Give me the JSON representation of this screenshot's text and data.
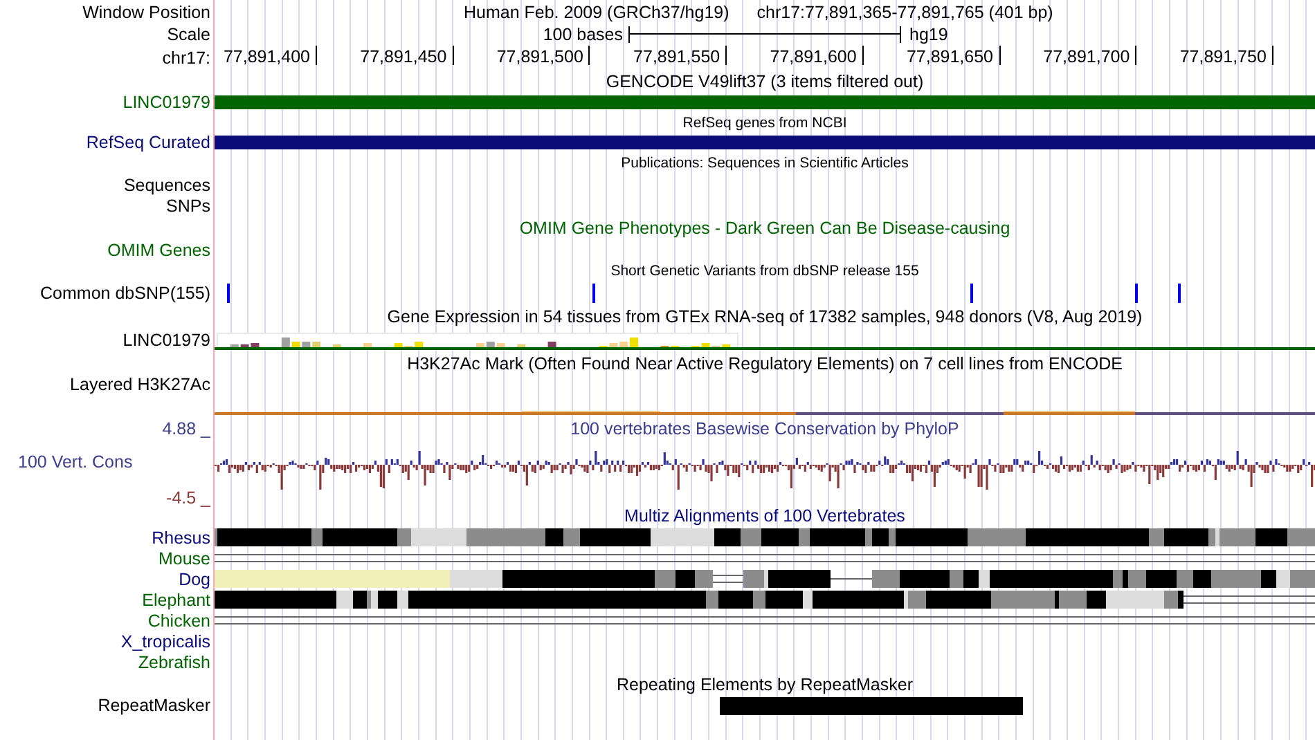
{
  "rows": [
    {
      "kind": "header",
      "label": {
        "text": "Window Position",
        "color": "#000000"
      },
      "title": "Human Feb. 2009 (GRCh37/hg19)",
      "position": "chr17:77,891,365-77,891,765 (401 bp)"
    },
    {
      "kind": "scale",
      "label": {
        "text": "Scale",
        "color": "#000000"
      },
      "scale_text": "100 bases",
      "assembly": "hg19"
    },
    {
      "kind": "ruler",
      "label": {
        "text": "chr17:",
        "color": "#000000"
      },
      "ticks": [
        "77,891,400",
        "77,891,450",
        "77,891,500",
        "77,891,550",
        "77,891,600",
        "77,891,650",
        "77,891,700",
        "77,891,750"
      ]
    },
    {
      "kind": "title",
      "title": {
        "text": "GENCODE V49lift37 (3 items filtered out)",
        "color": "#000000"
      }
    },
    {
      "kind": "gene",
      "label": {
        "text": "LINC01979",
        "color": "#006400"
      },
      "color": "#006400"
    },
    {
      "kind": "small-title",
      "title": {
        "text": "RefSeq genes from NCBI",
        "color": "#000000"
      }
    },
    {
      "kind": "gene",
      "label": {
        "text": "RefSeq Curated",
        "color": "#0c0c78"
      },
      "color": "#0c0c78"
    },
    {
      "kind": "small-title",
      "title": {
        "text": "Publications: Sequences in Scientific Articles",
        "color": "#000000"
      }
    },
    {
      "kind": "label",
      "label": {
        "text": "Sequences",
        "color": "#000000"
      }
    },
    {
      "kind": "label",
      "label": {
        "text": "SNPs",
        "color": "#000000"
      }
    },
    {
      "kind": "title",
      "title": {
        "text": "OMIM Gene Phenotypes - Dark Green Can Be Disease-causing",
        "color": "#006400"
      }
    },
    {
      "kind": "label",
      "label": {
        "text": "OMIM Genes",
        "color": "#006400"
      }
    },
    {
      "kind": "small-title",
      "title": {
        "text": "Short Genetic Variants from dbSNP release 155",
        "color": "#000000"
      }
    },
    {
      "kind": "snp",
      "label": {
        "text": "Common dbSNP(155)",
        "color": "#000000"
      }
    },
    {
      "kind": "title",
      "title": {
        "text": "Gene Expression in 54 tissues from GTEx RNA-seq of 17382 samples, 948 donors (V8, Aug 2019)",
        "color": "#000000"
      }
    },
    {
      "kind": "expression",
      "label": {
        "text": "LINC01979",
        "color": "#000000"
      }
    },
    {
      "kind": "title",
      "title": {
        "text": "H3K27Ac Mark (Often Found Near Active Regulatory Elements) on 7 cell lines from ENCODE",
        "color": "#000000"
      }
    },
    {
      "kind": "signal",
      "label": {
        "text": "Layered H3K27Ac",
        "color": "#000000"
      }
    },
    {
      "kind": "conservation",
      "labels": [
        {
          "text": "4.88 _",
          "color": "#3c3c8c"
        },
        {
          "text": "100 Vert. Cons",
          "color": "#3c3c8c"
        },
        {
          "text": "-4.5 _",
          "color": "#8b3a3a"
        }
      ],
      "title": {
        "text": "100 vertebrates Basewise Conservation by PhyloP",
        "color": "#3c3c8c"
      }
    },
    {
      "kind": "title",
      "title": {
        "text": "Multiz Alignments of 100 Vertebrates",
        "color": "#0c0c78"
      }
    },
    {
      "kind": "species",
      "label": {
        "text": "Rhesus",
        "color": "#0c0c78"
      },
      "alignment": {
        "kind": "blocks"
      }
    },
    {
      "kind": "species",
      "label": {
        "text": "Mouse",
        "color": "#006400"
      },
      "alignment": {
        "kind": "lines"
      }
    },
    {
      "kind": "species",
      "label": {
        "text": "Dog",
        "color": "#0c0c78"
      },
      "alignment": {
        "kind": "gapped"
      }
    },
    {
      "kind": "species",
      "label": {
        "text": "Elephant",
        "color": "#006400"
      },
      "alignment": {
        "kind": "partial"
      }
    },
    {
      "kind": "species",
      "label": {
        "text": "Chicken",
        "color": "#006400"
      },
      "alignment": {
        "kind": "lines"
      }
    },
    {
      "kind": "species",
      "label": {
        "text": "X_tropicalis",
        "color": "#0c0c78"
      }
    },
    {
      "kind": "species",
      "label": {
        "text": "Zebrafish",
        "color": "#006400"
      }
    },
    {
      "kind": "title",
      "title": {
        "text": "Repeating Elements by RepeatMasker",
        "color": "#000000"
      }
    },
    {
      "kind": "repeat",
      "label": {
        "text": "RepeatMasker",
        "color": "#000000"
      }
    }
  ]
}
